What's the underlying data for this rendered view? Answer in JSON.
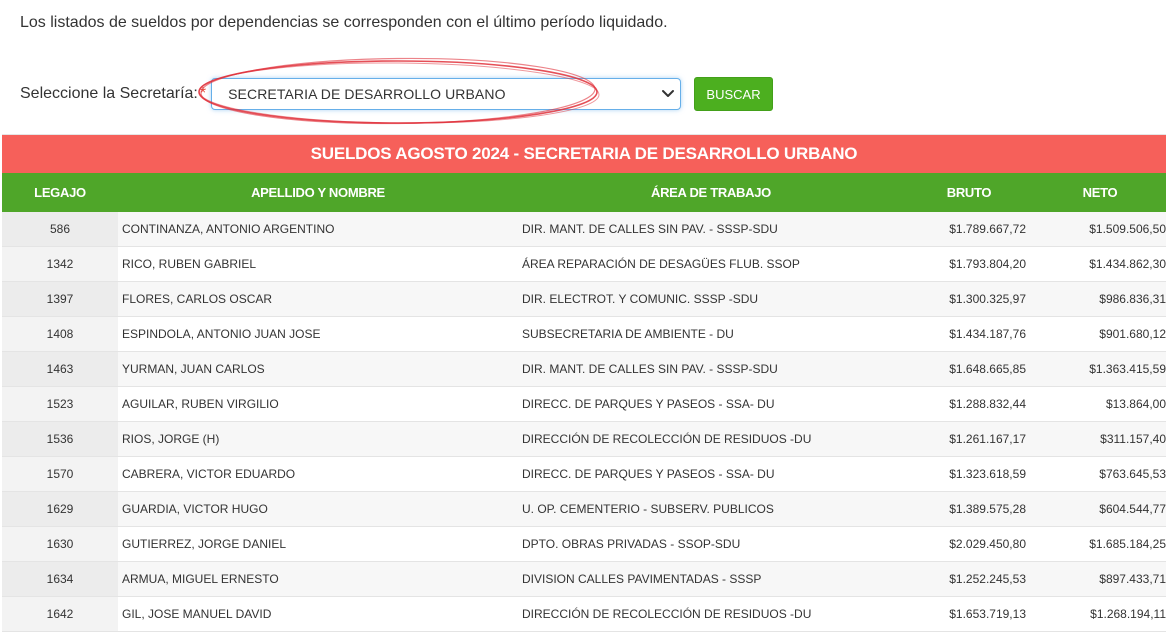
{
  "intro_text": "Los listados de sueldos por dependencias se corresponden con el último período liquidado.",
  "form": {
    "label": "Seleccione la Secretaría:",
    "required_mark": "*",
    "selected": "SECRETARIA DE DESARROLLO URBANO",
    "search_button": "BUSCAR"
  },
  "table": {
    "title": "SUELDOS AGOSTO 2024 - SECRETARIA DE DESARROLLO URBANO",
    "headers": [
      "LEGAJO",
      "APELLIDO Y NOMBRE",
      "ÁREA DE TRABAJO",
      "BRUTO",
      "NETO"
    ],
    "rows": [
      {
        "legajo": "586",
        "nombre": "CONTINANZA, ANTONIO ARGENTINO",
        "area": "DIR. MANT. DE CALLES SIN PAV. - SSSP-SDU",
        "bruto": "$1.789.667,72",
        "neto": "$1.509.506,50"
      },
      {
        "legajo": "1342",
        "nombre": "RICO, RUBEN GABRIEL",
        "area": "ÁREA REPARACIÓN DE DESAGÜES FLUB. SSOP",
        "bruto": "$1.793.804,20",
        "neto": "$1.434.862,30"
      },
      {
        "legajo": "1397",
        "nombre": "FLORES, CARLOS OSCAR",
        "area": "DIR. ELECTROT. Y COMUNIC. SSSP -SDU",
        "bruto": "$1.300.325,97",
        "neto": "$986.836,31"
      },
      {
        "legajo": "1408",
        "nombre": "ESPINDOLA, ANTONIO JUAN JOSE",
        "area": "SUBSECRETARIA DE AMBIENTE - DU",
        "bruto": "$1.434.187,76",
        "neto": "$901.680,12"
      },
      {
        "legajo": "1463",
        "nombre": "YURMAN, JUAN CARLOS",
        "area": "DIR. MANT. DE CALLES SIN PAV. - SSSP-SDU",
        "bruto": "$1.648.665,85",
        "neto": "$1.363.415,59"
      },
      {
        "legajo": "1523",
        "nombre": "AGUILAR, RUBEN VIRGILIO",
        "area": "DIRECC. DE PARQUES Y PASEOS - SSA- DU",
        "bruto": "$1.288.832,44",
        "neto": "$13.864,00"
      },
      {
        "legajo": "1536",
        "nombre": "RIOS, JORGE (H)",
        "area": "DIRECCIÓN DE RECOLECCIÓN DE RESIDUOS -DU",
        "bruto": "$1.261.167,17",
        "neto": "$311.157,40"
      },
      {
        "legajo": "1570",
        "nombre": "CABRERA, VICTOR EDUARDO",
        "area": "DIRECC. DE PARQUES Y PASEOS - SSA- DU",
        "bruto": "$1.323.618,59",
        "neto": "$763.645,53"
      },
      {
        "legajo": "1629",
        "nombre": "GUARDIA, VICTOR HUGO",
        "area": "U. OP. CEMENTERIO - SUBSERV. PUBLICOS",
        "bruto": "$1.389.575,28",
        "neto": "$604.544,77"
      },
      {
        "legajo": "1630",
        "nombre": "GUTIERREZ, JORGE DANIEL",
        "area": "DPTO. OBRAS PRIVADAS - SSOP-SDU",
        "bruto": "$2.029.450,80",
        "neto": "$1.685.184,25"
      },
      {
        "legajo": "1634",
        "nombre": "ARMUA, MIGUEL ERNESTO",
        "area": "DIVISION CALLES PAVIMENTADAS - SSSP",
        "bruto": "$1.252.245,53",
        "neto": "$897.433,71"
      },
      {
        "legajo": "1642",
        "nombre": "GIL, JOSE MANUEL DAVID",
        "area": "DIRECCIÓN DE RECOLECCIÓN DE RESIDUOS -DU",
        "bruto": "$1.653.719,13",
        "neto": "$1.268.194,11"
      }
    ]
  },
  "colors": {
    "title_bar": "#f6605a",
    "header_bar": "#4fa629",
    "button": "#4caf1f",
    "annotation": "#e0303a"
  },
  "icons": {
    "select": "chevron-down-icon"
  }
}
